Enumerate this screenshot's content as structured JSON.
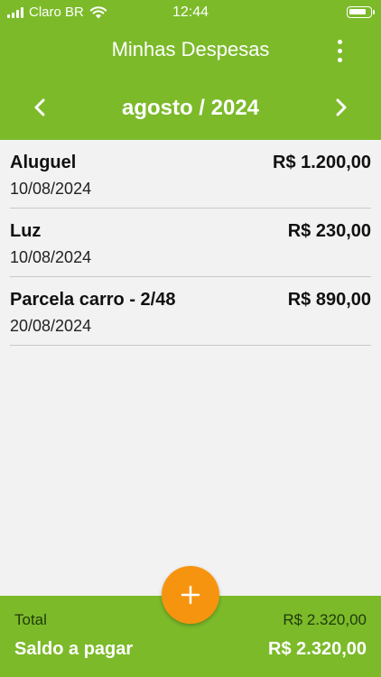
{
  "status_bar": {
    "carrier": "Claro BR",
    "time": "12:44",
    "icons": [
      "signal-icon",
      "wifi-icon",
      "battery-icon"
    ]
  },
  "header": {
    "title": "Minhas Despesas",
    "menu_icon": "more-vertical-icon"
  },
  "month_nav": {
    "label": "agosto / 2024",
    "prev_icon": "chevron-left-icon",
    "next_icon": "chevron-right-icon"
  },
  "expenses": [
    {
      "title": "Aluguel",
      "date": "10/08/2024",
      "amount": "R$ 1.200,00"
    },
    {
      "title": "Luz",
      "date": "10/08/2024",
      "amount": "R$ 230,00"
    },
    {
      "title": "Parcela carro - 2/48",
      "date": "20/08/2024",
      "amount": "R$ 890,00"
    }
  ],
  "add_button": {
    "icon": "plus-icon"
  },
  "footer": {
    "total_label": "Total",
    "total_value": "R$ 2.320,00",
    "saldo_label": "Saldo a pagar",
    "saldo_value": "R$ 2.320,00"
  },
  "colors": {
    "primary": "#7cba2a",
    "accent": "#f7940f",
    "background": "#f2f2f2"
  }
}
